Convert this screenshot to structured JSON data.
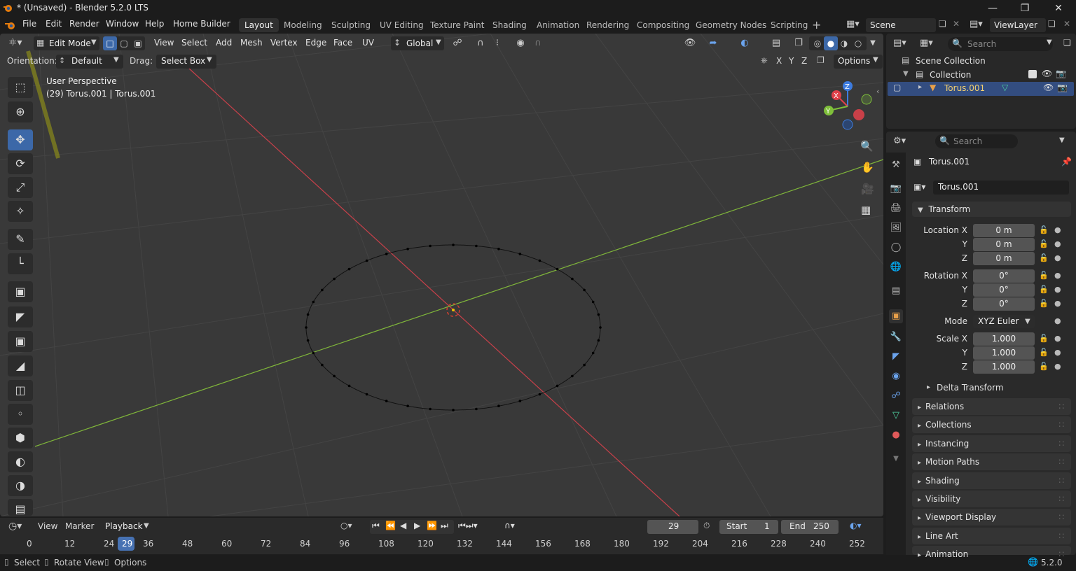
{
  "window": {
    "title": "* (Unsaved) - Blender 5.2.0 LTS"
  },
  "menu": [
    "File",
    "Edit",
    "Render",
    "Window",
    "Help",
    "Home Builder"
  ],
  "workspaces": [
    "Layout",
    "Modeling",
    "Sculpting",
    "UV Editing",
    "Texture Paint",
    "Shading",
    "Animation",
    "Rendering",
    "Compositing",
    "Geometry Nodes",
    "Scripting"
  ],
  "scene_name": "Scene",
  "view_layer": "ViewLayer",
  "viewport": {
    "mode": "Edit Mode",
    "menus": [
      "View",
      "Select",
      "Add",
      "Mesh",
      "Vertex",
      "Edge",
      "Face",
      "UV"
    ],
    "transform_orientation": "Global",
    "orientation_label": "Orientation:",
    "orientation_value": "Default",
    "drag_label": "Drag:",
    "drag_value": "Select Box",
    "axes": [
      "X",
      "Y",
      "Z"
    ],
    "options": "Options",
    "info_line1": "User Perspective",
    "info_line2": "(29) Torus.001 | Torus.001"
  },
  "gizmo": {
    "z": "Z",
    "x": "X",
    "y": "Y"
  },
  "timeline": {
    "menus": [
      "View",
      "Marker",
      "Playback"
    ],
    "current_frame": "29",
    "start_label": "Start",
    "start": "1",
    "end_label": "End",
    "end": "250",
    "ticks": [
      "0",
      "12",
      "24",
      "29",
      "36",
      "48",
      "60",
      "72",
      "84",
      "96",
      "108",
      "120",
      "132",
      "144",
      "156",
      "168",
      "180",
      "192",
      "204",
      "216",
      "228",
      "240",
      "252"
    ]
  },
  "status": {
    "select": "Select",
    "rotate": "Rotate View",
    "options": "Options",
    "version": "5.2.0"
  },
  "outliner": {
    "search_placeholder": "Search",
    "scene_collection": "Scene Collection",
    "collection": "Collection",
    "object": "Torus.001"
  },
  "properties": {
    "search_placeholder": "Search",
    "object_header": "Torus.001",
    "object_name": "Torus.001",
    "transform_label": "Transform",
    "location_label": "Location X",
    "rotation_label": "Rotation X",
    "scale_label": "Scale X",
    "y_label": "Y",
    "z_label": "Z",
    "mode_label": "Mode",
    "location": [
      "0 m",
      "0 m",
      "0 m"
    ],
    "rotation": [
      "0°",
      "0°",
      "0°"
    ],
    "mode": "XYZ Euler",
    "scale": [
      "1.000",
      "1.000",
      "1.000"
    ],
    "delta": "Delta Transform",
    "panels": [
      "Relations",
      "Collections",
      "Instancing",
      "Motion Paths",
      "Shading",
      "Visibility",
      "Viewport Display",
      "Line Art",
      "Animation"
    ]
  },
  "colors": {
    "accent": "#4772b3",
    "x_axis": "#e0404a",
    "y_axis": "#7fbf3a",
    "z_axis": "#3d7ce0"
  }
}
